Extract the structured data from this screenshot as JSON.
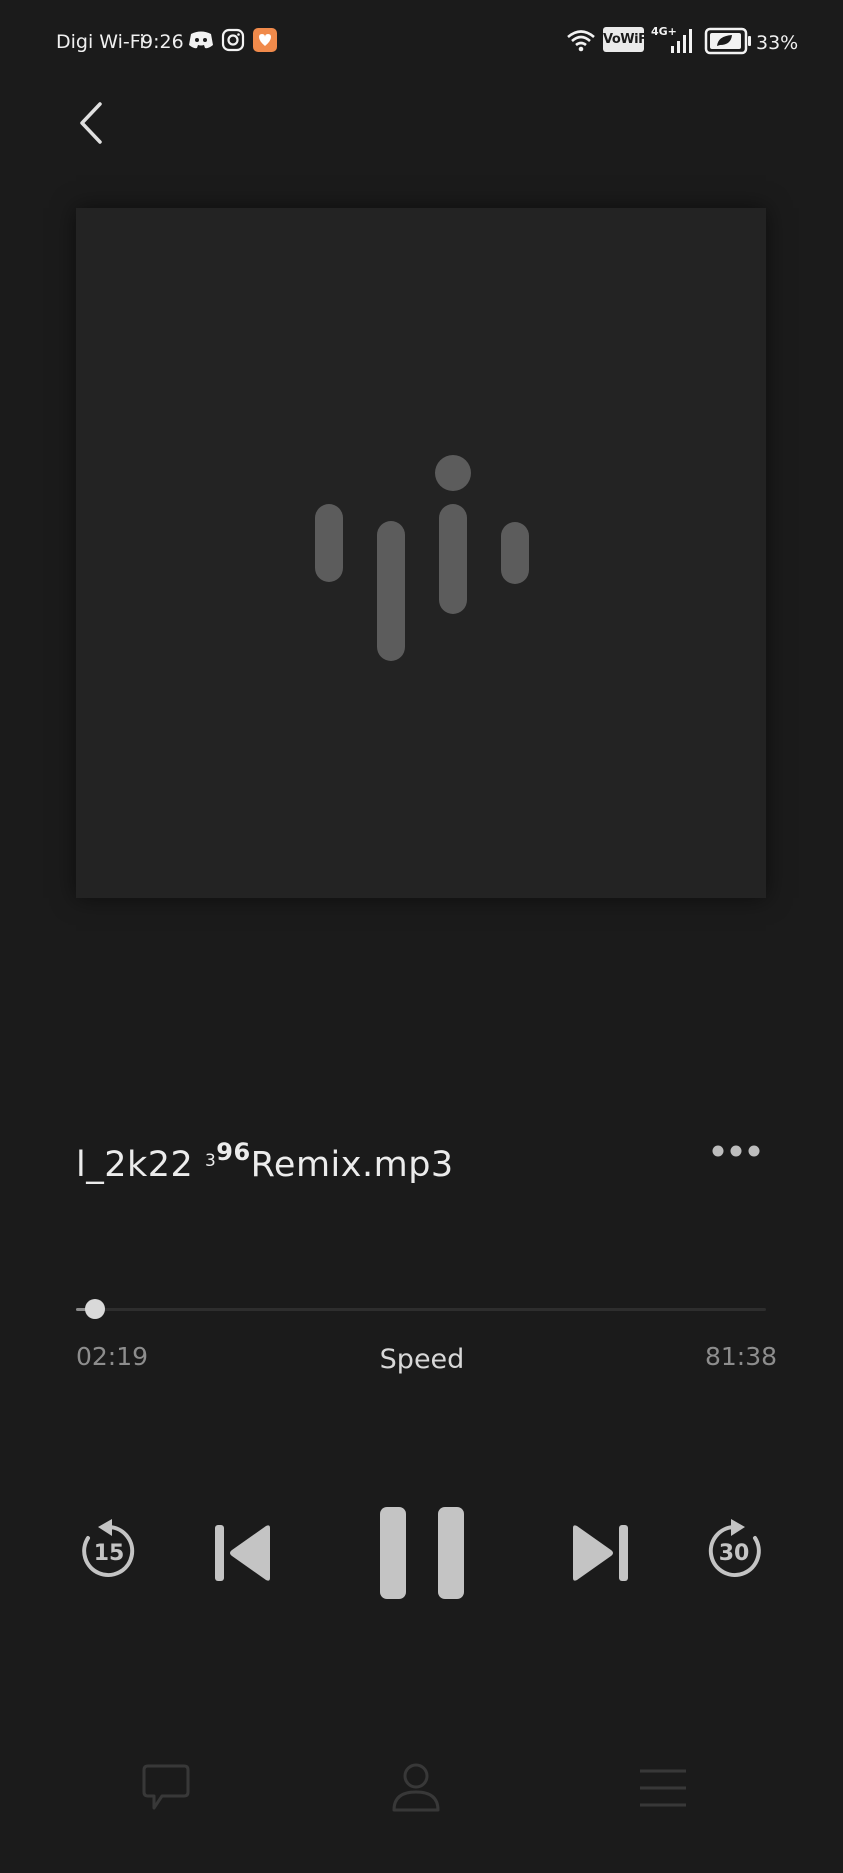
{
  "status_bar": {
    "carrier": "Digi Wi-Fi",
    "time": "9:26",
    "vowifi": "VoWiFi",
    "network": "4G+",
    "battery": "33%",
    "icons": [
      "discord-icon",
      "instagram-icon",
      "app-notification-icon",
      "wifi-icon",
      "signal-icon",
      "battery-icon"
    ]
  },
  "player": {
    "track_name": "l_2k22",
    "track_superscript_small": "3",
    "track_superscript": "96",
    "track_suffix": "Remix.mp3",
    "elapsed": "02:19",
    "total": "81:38",
    "speed_label": "Speed",
    "progress_fraction": 0.028,
    "is_playing": true
  },
  "controls": {
    "rewind_seconds": "15",
    "forward_seconds": "30"
  },
  "bottom_nav": {
    "items": [
      "chat-icon",
      "profile-icon",
      "menu-icon"
    ]
  },
  "colors": {
    "background": "#1b1b1b",
    "artwork_bg": "#232323",
    "logo": "#5c5c5c",
    "control": "#c4c4c4",
    "accent_orange": "#f08a4b"
  }
}
